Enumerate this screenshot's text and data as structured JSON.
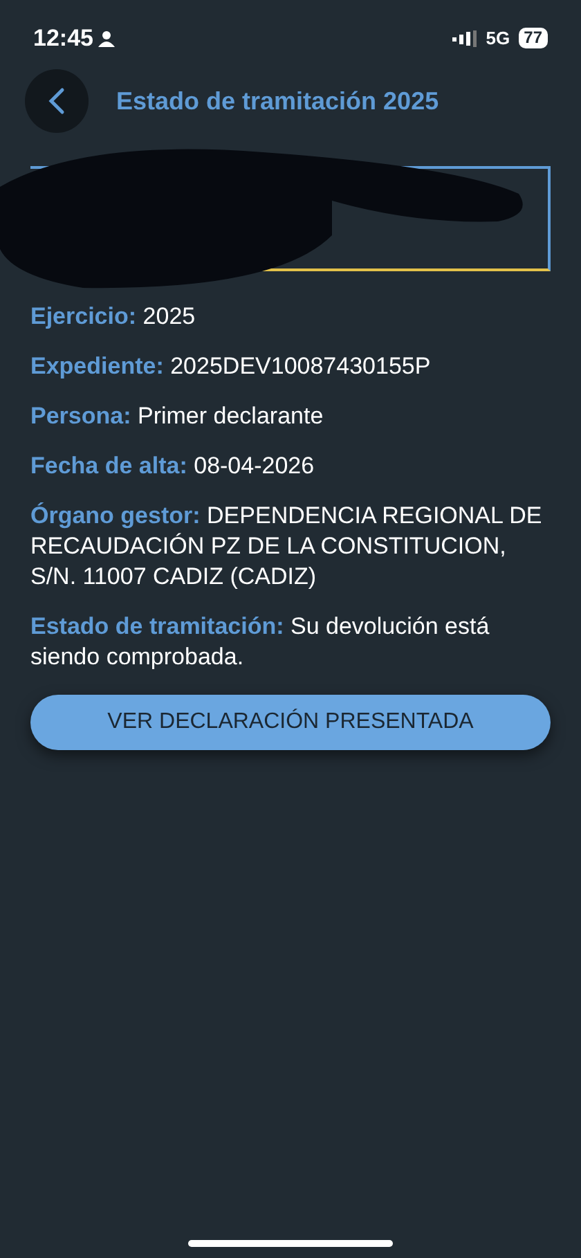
{
  "status_bar": {
    "time": "12:45",
    "network": "5G",
    "battery": "77"
  },
  "header": {
    "title": "Estado de tramitación 2025"
  },
  "fields": [
    {
      "label": "Ejercicio:",
      "value": "2025"
    },
    {
      "label": "Expediente:",
      "value": "2025DEV10087430155P"
    },
    {
      "label": "Persona:",
      "value": "Primer declarante"
    },
    {
      "label": "Fecha de alta:",
      "value": "08-04-2026"
    },
    {
      "label": "Órgano gestor:",
      "value": "DEPENDENCIA REGIONAL DE RECAUDACIÓN  PZ DE LA CONSTITUCION, S/N. 11007 CADIZ (CADIZ)"
    },
    {
      "label": "Estado de tramitación:",
      "value": "Su devolución está siendo comprobada."
    }
  ],
  "button": {
    "label": "VER DECLARACIÓN PRESENTADA"
  }
}
